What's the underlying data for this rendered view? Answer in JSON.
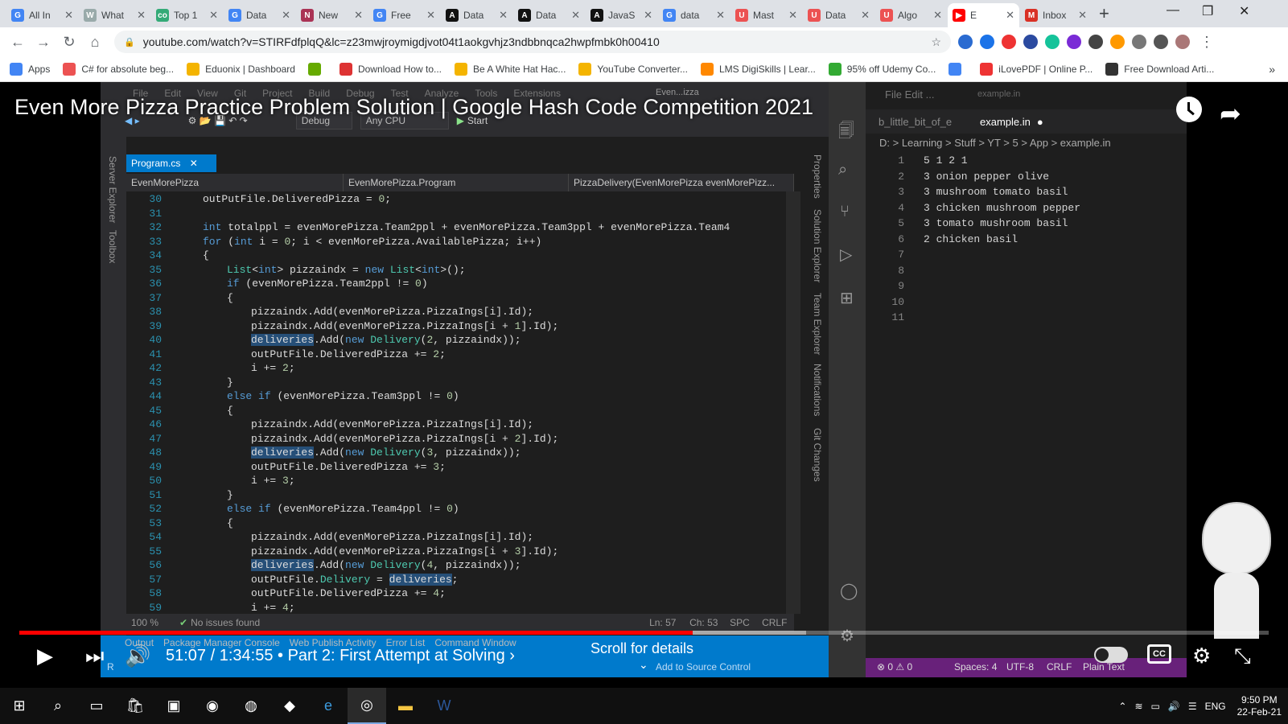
{
  "tabs": [
    {
      "label": "All In",
      "favicon": "G",
      "color": "#4285f4"
    },
    {
      "label": "What",
      "favicon": "W",
      "color": "#9aa"
    },
    {
      "label": "Top 1",
      "favicon": "co",
      "color": "#3a7"
    },
    {
      "label": "Data",
      "favicon": "G",
      "color": "#4285f4"
    },
    {
      "label": "New",
      "favicon": "N",
      "color": "#a35"
    },
    {
      "label": "Free",
      "favicon": "G",
      "color": "#4285f4"
    },
    {
      "label": "Data",
      "favicon": "A",
      "color": "#111"
    },
    {
      "label": "Data",
      "favicon": "A",
      "color": "#111"
    },
    {
      "label": "JavaS",
      "favicon": "A",
      "color": "#111"
    },
    {
      "label": "data",
      "favicon": "G",
      "color": "#4285f4"
    },
    {
      "label": "Mast",
      "favicon": "U",
      "color": "#ec5252"
    },
    {
      "label": "Data",
      "favicon": "U",
      "color": "#ec5252"
    },
    {
      "label": "Algo",
      "favicon": "U",
      "color": "#ec5252"
    },
    {
      "label": "E",
      "favicon": "▶",
      "color": "#f00"
    },
    {
      "label": "Inbox",
      "favicon": "M",
      "color": "#d93025"
    }
  ],
  "active_tab_index": 13,
  "url": "youtube.com/watch?v=STIRFdfplqQ&lc=z23mwjroymigdjvot04t1aokgvhjz3ndbbnqca2hwpfmbk0h00410",
  "bookmarks": [
    {
      "label": "Apps",
      "color": "#4285f4"
    },
    {
      "label": "C# for absolute beg...",
      "color": "#ec5252"
    },
    {
      "label": "Eduonix | Dashboard",
      "color": "#f4b400"
    },
    {
      "label": "",
      "color": "#6a0"
    },
    {
      "label": "Download How to...",
      "color": "#d33"
    },
    {
      "label": "Be A White Hat Hac...",
      "color": "#f4b400"
    },
    {
      "label": "YouTube Converter...",
      "color": "#f4b400"
    },
    {
      "label": "LMS DigiSkills | Lear...",
      "color": "#f80"
    },
    {
      "label": "95% off Udemy Co...",
      "color": "#3a3"
    },
    {
      "label": "",
      "color": "#4285f4"
    },
    {
      "label": "iLovePDF | Online P...",
      "color": "#e33"
    },
    {
      "label": "Free Download Arti...",
      "color": "#333"
    }
  ],
  "video": {
    "title": "Even More Pizza Practice Problem Solution | Google Hash Code Competition 2021",
    "time_current": "51:07",
    "time_total": "1:34:55",
    "chapter": "Part 2: First Attempt at Solving",
    "scroll_hint": "Scroll for details",
    "progress": 0.539,
    "buffered": 0.63
  },
  "ide": {
    "menu": [
      "File",
      "Edit",
      "View",
      "Git",
      "Project",
      "Build",
      "Debug",
      "Test",
      "Analyze",
      "Tools",
      "Extensions"
    ],
    "window_title": "Even...izza",
    "config": "Debug",
    "platform": "Any CPU",
    "start": "Start",
    "file_tab": "Program.cs",
    "nav": [
      "EvenMorePizza",
      "EvenMorePizza.Program",
      "PizzaDelivery(EvenMorePizza evenMorePizz..."
    ],
    "side_left": [
      "Server Explorer",
      "Toolbox"
    ],
    "side_right": [
      "Properties",
      "Solution Explorer",
      "Team Explorer",
      "Notifications",
      "Git Changes"
    ],
    "zoom": "100 %",
    "issues": "No issues found",
    "ln": "Ln: 57",
    "ch": "Ch: 53",
    "spc": "SPC",
    "crlf": "CRLF",
    "bottom_tabs": [
      "Output",
      "Package Manager Console",
      "Web Publish Activity",
      "Error List",
      "Command Window"
    ],
    "source_control": "Add to Source Control",
    "ready": "R",
    "code": [
      {
        "n": "30",
        "i": 0,
        "t": "outPutFile.DeliveredPizza = 0;"
      },
      {
        "n": "31",
        "i": 0,
        "t": ""
      },
      {
        "n": "32",
        "i": 0,
        "t": "int totalppl = evenMorePizza.Team2ppl + evenMorePizza.Team3ppl + evenMorePizza.Team4"
      },
      {
        "n": "33",
        "i": 0,
        "t": "for (int i = 0; i < evenMorePizza.AvailablePizza; i++)"
      },
      {
        "n": "34",
        "i": 0,
        "t": "{"
      },
      {
        "n": "35",
        "i": 1,
        "t": "List<int> pizzaindx = new List<int>();"
      },
      {
        "n": "36",
        "i": 1,
        "t": "if (evenMorePizza.Team2ppl != 0)"
      },
      {
        "n": "37",
        "i": 1,
        "t": "{"
      },
      {
        "n": "38",
        "i": 2,
        "t": "pizzaindx.Add(evenMorePizza.PizzaIngs[i].Id);"
      },
      {
        "n": "39",
        "i": 2,
        "t": "pizzaindx.Add(evenMorePizza.PizzaIngs[i + 1].Id);"
      },
      {
        "n": "40",
        "i": 2,
        "t": "deliveries.Add(new Delivery(2, pizzaindx));"
      },
      {
        "n": "41",
        "i": 2,
        "t": "outPutFile.DeliveredPizza += 2;"
      },
      {
        "n": "42",
        "i": 2,
        "t": "i += 2;"
      },
      {
        "n": "43",
        "i": 1,
        "t": "}"
      },
      {
        "n": "44",
        "i": 1,
        "t": "else if (evenMorePizza.Team3ppl != 0)"
      },
      {
        "n": "45",
        "i": 1,
        "t": "{"
      },
      {
        "n": "46",
        "i": 2,
        "t": "pizzaindx.Add(evenMorePizza.PizzaIngs[i].Id);"
      },
      {
        "n": "47",
        "i": 2,
        "t": "pizzaindx.Add(evenMorePizza.PizzaIngs[i + 2].Id);"
      },
      {
        "n": "48",
        "i": 2,
        "t": "deliveries.Add(new Delivery(3, pizzaindx));"
      },
      {
        "n": "49",
        "i": 2,
        "t": "outPutFile.DeliveredPizza += 3;"
      },
      {
        "n": "50",
        "i": 2,
        "t": "i += 3;"
      },
      {
        "n": "51",
        "i": 1,
        "t": "}"
      },
      {
        "n": "52",
        "i": 1,
        "t": "else if (evenMorePizza.Team4ppl != 0)"
      },
      {
        "n": "53",
        "i": 1,
        "t": "{"
      },
      {
        "n": "54",
        "i": 2,
        "t": "pizzaindx.Add(evenMorePizza.PizzaIngs[i].Id);"
      },
      {
        "n": "55",
        "i": 2,
        "t": "pizzaindx.Add(evenMorePizza.PizzaIngs[i + 3].Id);"
      },
      {
        "n": "56",
        "i": 2,
        "t": "deliveries.Add(new Delivery(4, pizzaindx));"
      },
      {
        "n": "57",
        "i": 2,
        "t": "outPutFile.Delivery = deliveries;"
      },
      {
        "n": "58",
        "i": 2,
        "t": "outPutFile.DeliveredPizza += 4;"
      },
      {
        "n": "59",
        "i": 2,
        "t": "i += 4;"
      }
    ]
  },
  "vscode": {
    "menu": [
      "File",
      "Edit",
      "..."
    ],
    "title": "example.in",
    "tabs": [
      "b_little_bit_of_e",
      "example.in"
    ],
    "breadcrumb": "D: > Learning > Stuff > YT > 5 > App > example.in",
    "lines": [
      "5 1 2 1",
      "3 onion pepper olive",
      "3 mushroom tomato basil",
      "3 chicken mushroom pepper",
      "3 tomato mushroom basil",
      "2 chicken basil",
      "",
      "",
      "",
      "",
      ""
    ],
    "status": [
      "⊗ 0 ⚠ 0",
      "Spaces: 4",
      "UTF-8",
      "CRLF",
      "Plain Text"
    ]
  },
  "taskbar": {
    "lang": "ENG",
    "time": "9:50 PM",
    "date": "22-Feb-21"
  }
}
